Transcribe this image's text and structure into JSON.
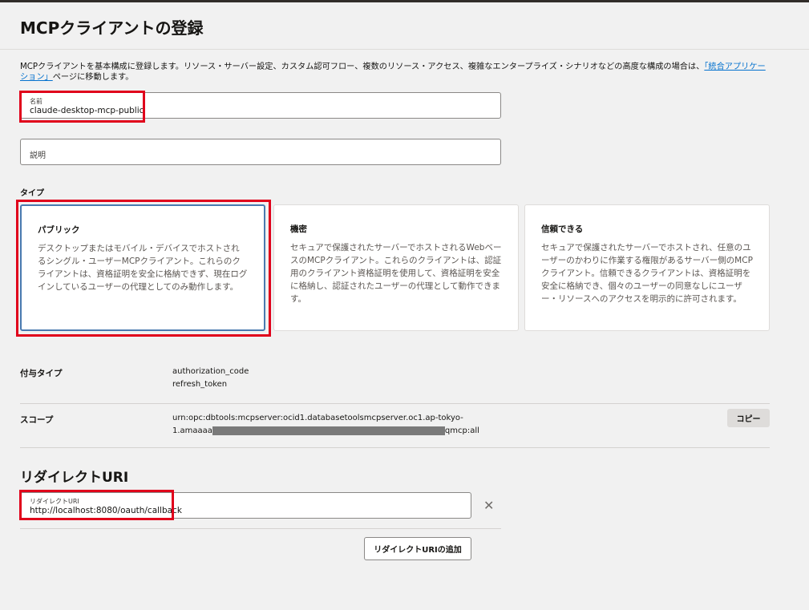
{
  "page": {
    "title": "MCPクライアントの登録",
    "intro_text": "MCPクライアントを基本構成に登録します。リソース・サーバー設定、カスタム認可フロー、複数のリソース・アクセス、複雑なエンタープライズ・シナリオなどの高度な構成の場合は、",
    "intro_link": "「統合アプリケーション」",
    "intro_suffix": "ページに移動します。"
  },
  "name_field": {
    "label": "名前",
    "value": "claude-desktop-mcp-public"
  },
  "description_field": {
    "placeholder": "説明"
  },
  "type_section": {
    "label": "タイプ",
    "cards": [
      {
        "title": "パブリック",
        "description": "デスクトップまたはモバイル・デバイスでホストされるシングル・ユーザーMCPクライアント。これらのクライアントは、資格証明を安全に格納できず、現在ログインしているユーザーの代理としてのみ動作します。",
        "selected": true
      },
      {
        "title": "機密",
        "description": "セキュアで保護されたサーバーでホストされるWebベースのMCPクライアント。これらのクライアントは、認証用のクライアント資格証明を使用して、資格証明を安全に格納し、認証されたユーザーの代理として動作できます。",
        "selected": false
      },
      {
        "title": "信頼できる",
        "description": "セキュアで保護されたサーバーでホストされ、任意のユーザーのかわりに作業する権限があるサーバー側のMCPクライアント。信頼できるクライアントは、資格証明を安全に格納でき、個々のユーザーの同意なしにユーザー・リソースへのアクセスを明示的に許可されます。",
        "selected": false
      }
    ]
  },
  "grant_types": {
    "label": "付与タイプ",
    "values": [
      "authorization_code",
      "refresh_token"
    ]
  },
  "scope": {
    "label": "スコープ",
    "line1": "urn:opc:dbtools:mcpserver:ocid1.databasetoolsmcpserver.oc1.ap-tokyo-",
    "line2_prefix": "1.amaaaa",
    "line2_suffix": "qmcp:all",
    "copy_button": "コピー"
  },
  "redirect": {
    "section_title": "リダイレクトURI",
    "field_label": "リダイレクトURI",
    "field_value": "http://localhost:8080/oauth/callback",
    "add_button": "リダイレクトURIの追加"
  },
  "colors": {
    "highlight": "#e0001b",
    "link": "#0572ce",
    "selected_border": "#4a7ab0"
  }
}
